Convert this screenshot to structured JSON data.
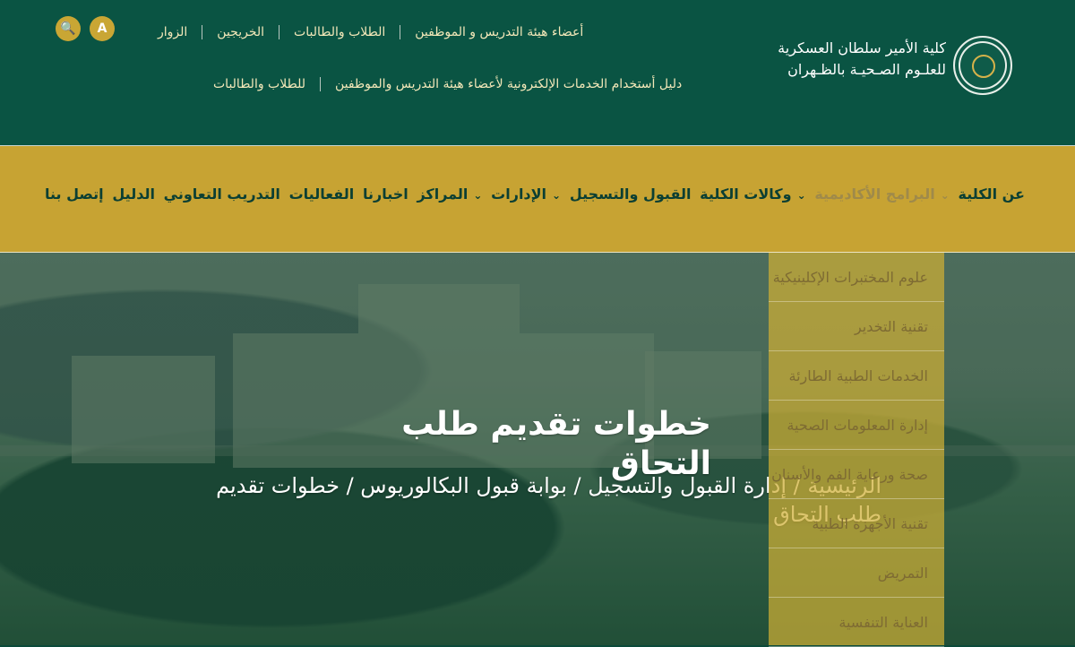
{
  "header": {
    "college_name_line1": "كلية الأمير سلطان العسكرية",
    "college_name_line2": "للعلـوم الصـحيـة بالظـهران"
  },
  "top_actions": {
    "search_label": "🔍",
    "language_label": "A"
  },
  "top_links": [
    "أعضاء هيئة التدريس و الموظفين",
    "الطلاب والطالبات",
    "الخريجين",
    "الزوار"
  ],
  "guide_links": [
    "دليل أستخدام الخدمات الإلكترونية لأعضاء هيئة التدريس والموظفين",
    "للطلاب والطالبات"
  ],
  "nav": [
    {
      "label": "عن الكلية"
    },
    {
      "label": "البرامج الأكاديمية"
    },
    {
      "label": "وكالات الكلية"
    },
    {
      "label": "القبول والتسجيل"
    },
    {
      "label": "الإدارات"
    },
    {
      "label": "المراكز"
    },
    {
      "label": "اخبارنا"
    },
    {
      "label": "الفعاليات"
    },
    {
      "label": "التدريب التعاوني"
    },
    {
      "label": "الدليل"
    },
    {
      "label": "إتصل بنا"
    }
  ],
  "hero": {
    "title": "خطوات تقديم طلب التحاق",
    "breadcrumb": "الرئيسية / إدارة القبول والتسجيل / بوابة قبول البكالوريوس / خطوات تقديم طلب التحاق"
  },
  "dropdown": {
    "items": [
      "علوم المختبرات الإكلينيكية",
      "تقنية التخدير",
      "الخدمات الطبية الطارئة",
      "إدارة المعلومات الصحية",
      "صحة ورعاية الفم والأسنان",
      "تقنية الأجهزة الطبية",
      "التمريض",
      "العناية التنفسية"
    ]
  },
  "colors": {
    "topbar": "#0a5443",
    "nav": "#c7a333",
    "accent": "#c9a634"
  }
}
